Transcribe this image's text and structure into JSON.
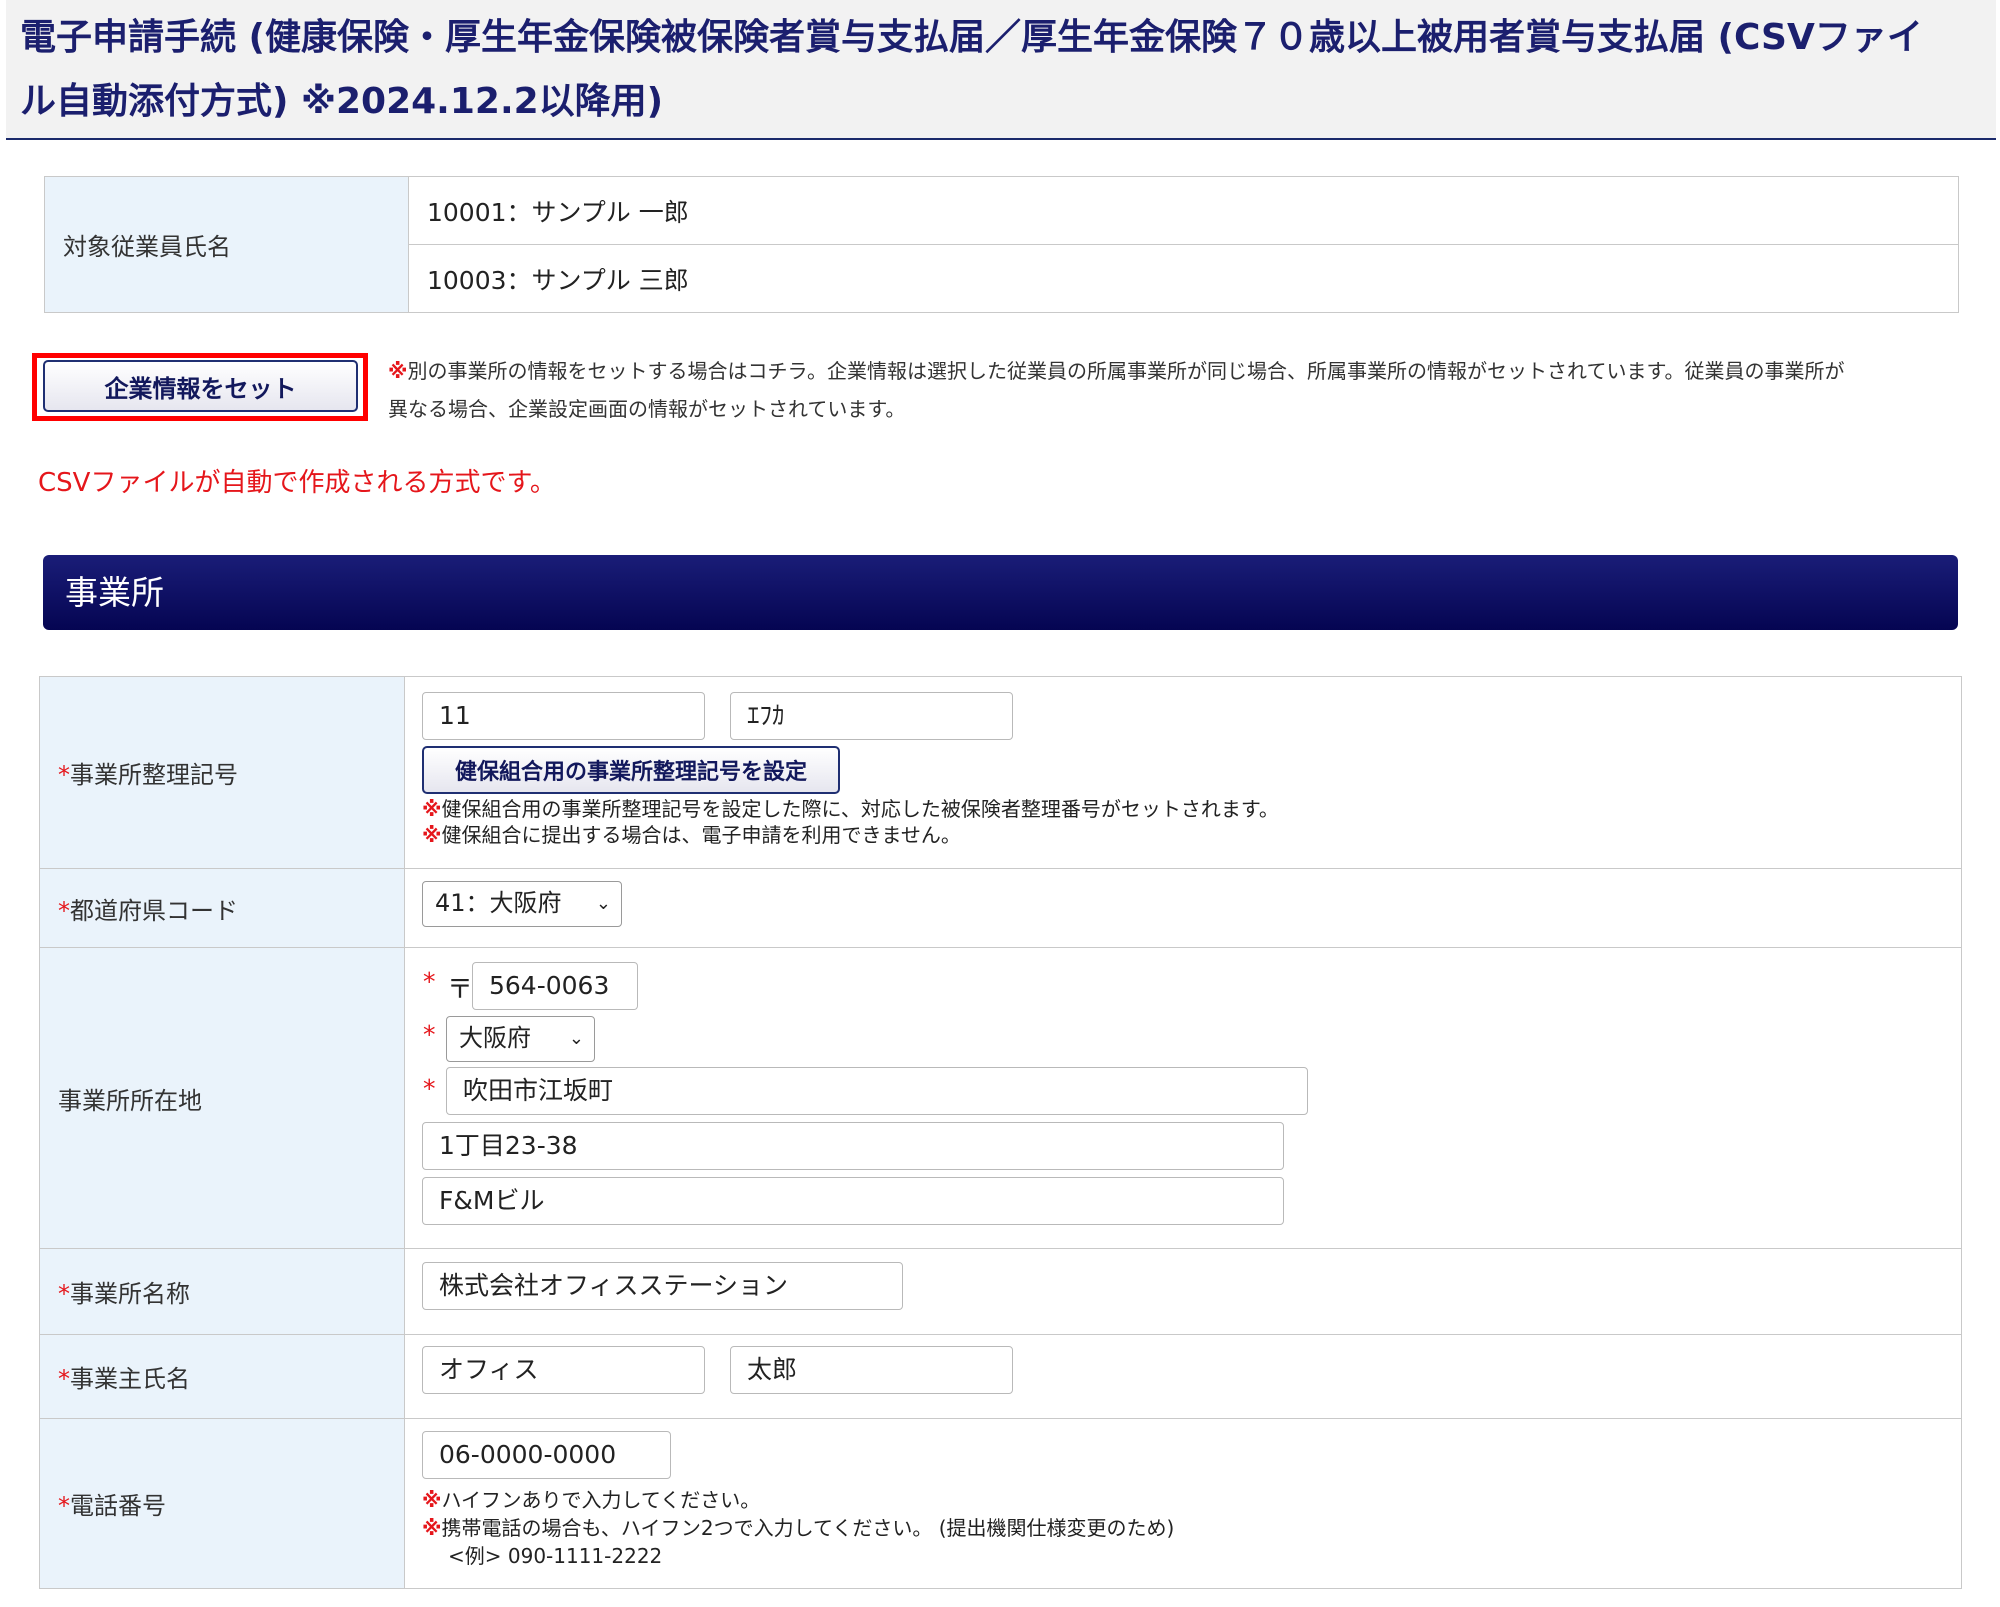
{
  "page": {
    "title_line1": "電子申請手続 (健康保険・厚生年金保険被保険者賞与支払届／厚生年金保険７０歳以上被用者賞与支払届 (CSVファイ",
    "title_line2": "ル自動添付方式) ※2024.12.2以降用)"
  },
  "employees": {
    "label": "対象従業員氏名",
    "items": [
      "10001：サンプル 一郎",
      "10003：サンプル 三郎"
    ]
  },
  "company_info": {
    "button_label": "企業情報をセット",
    "note_mark": "※",
    "note_line1": "別の事業所の情報をセットする場合はコチラ。企業情報は選択した従業員の所属事業所が同じ場合、所属事業所の情報がセットされています。従業員の事業所が",
    "note_line2": "異なる場合、企業設定画面の情報がセットされています。",
    "highlight_color": "#ff0000"
  },
  "csv_notice": "CSVファイルが自動で作成される方式です。",
  "section": {
    "title": "事業所"
  },
  "form": {
    "required_mark": "*",
    "note_mark": "※",
    "office_code": {
      "label": "事業所整理記号",
      "value1": "11",
      "value2": "ｴﾌｶ",
      "button_label": "健保組合用の事業所整理記号を設定",
      "note1": "健保組合用の事業所整理記号を設定した際に、対応した被保険者整理番号がセットされます。",
      "note2": "健保組合に提出する場合は、電子申請を利用できません。"
    },
    "prefecture_code": {
      "label": "都道府県コード",
      "selected": "41：大阪府"
    },
    "address": {
      "label": "事業所所在地",
      "postal_mark": "〒",
      "postal": "564-0063",
      "prefecture": "大阪府",
      "city": "吹田市江坂町",
      "line1": "1丁目23-38",
      "line2": "F&Mビル"
    },
    "office_name": {
      "label": "事業所名称",
      "value": "株式会社オフィスステーション"
    },
    "owner_name": {
      "label": "事業主氏名",
      "last": "オフィス",
      "first": "太郎"
    },
    "phone": {
      "label": "電話番号",
      "value": "06-0000-0000",
      "note1": "ハイフンありで入力してください。",
      "note2": "携帯電話の場合も、ハイフン2つで入力してください。 (提出機関仕様変更のため)",
      "example": "<例> 090-1111-2222"
    }
  },
  "colors": {
    "accent_red": "#e5161b",
    "navy": "#0b0b5e",
    "label_bg": "#eaf3fb"
  },
  "icons": {
    "select_arrow": "chevron-down-icon"
  }
}
